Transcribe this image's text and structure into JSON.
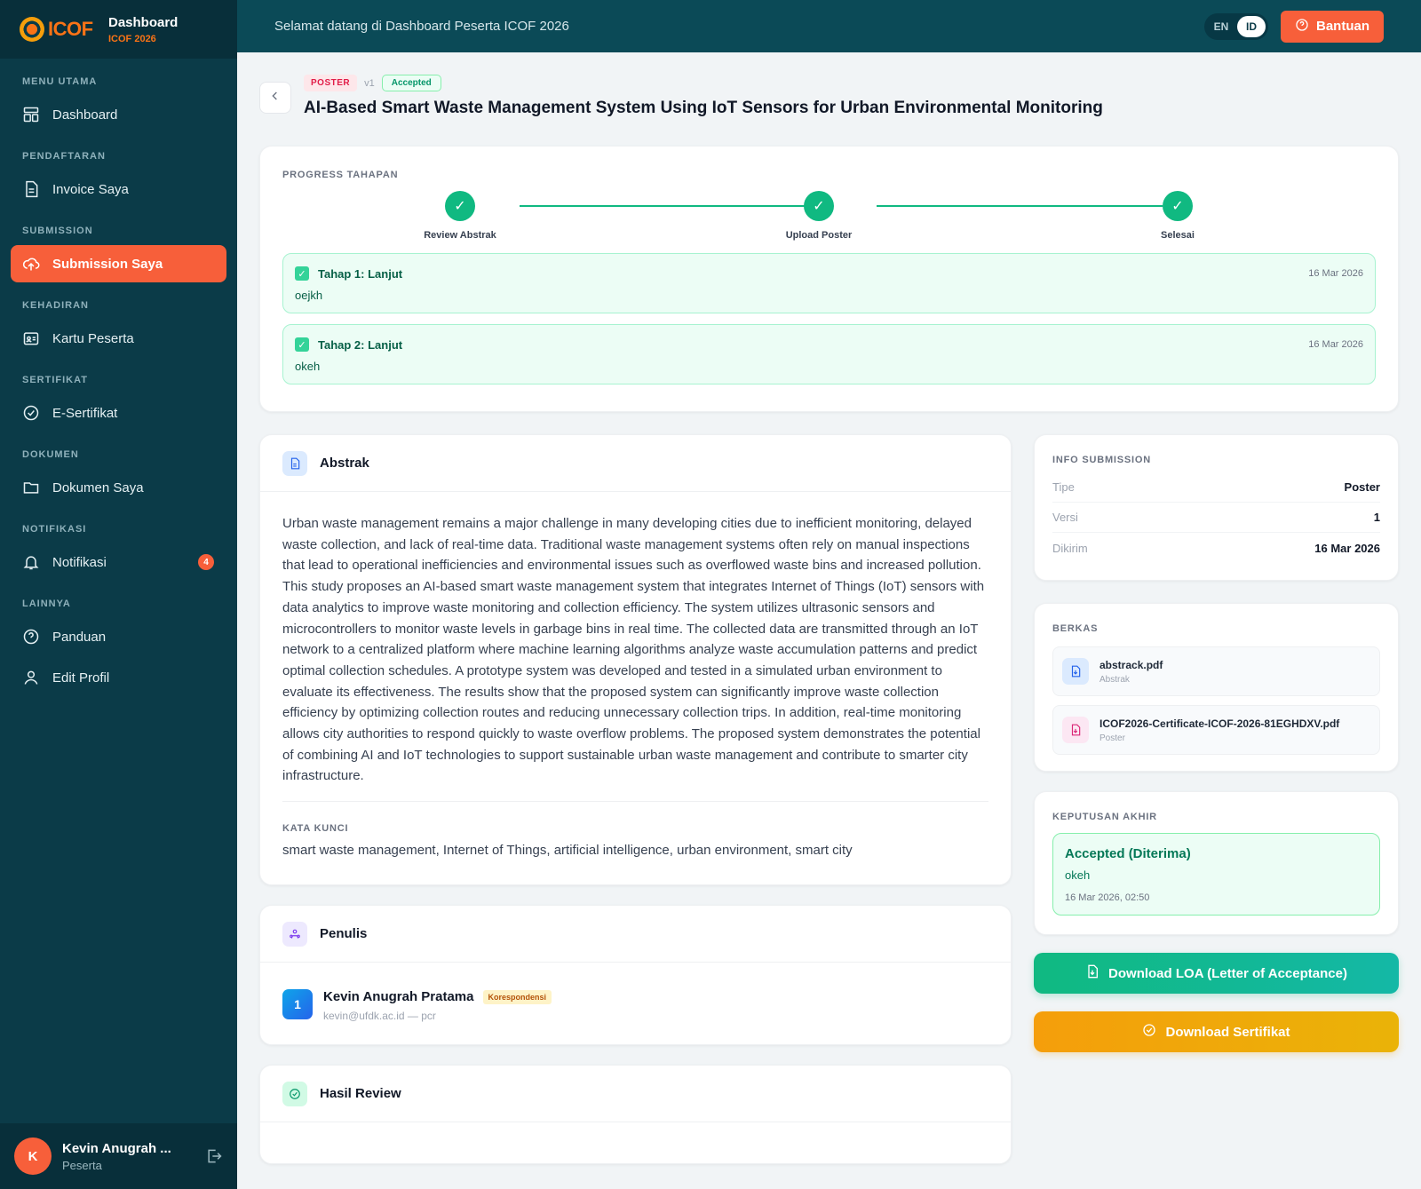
{
  "brand": {
    "logo_text": "ICOF",
    "title": "Dashboard",
    "subtitle": "ICOF 2026"
  },
  "sidebar": {
    "sections": [
      {
        "label": "MENU UTAMA",
        "items": [
          {
            "label": "Dashboard",
            "icon": "dashboard-icon"
          }
        ]
      },
      {
        "label": "PENDAFTARAN",
        "items": [
          {
            "label": "Invoice Saya",
            "icon": "document-icon"
          }
        ]
      },
      {
        "label": "SUBMISSION",
        "items": [
          {
            "label": "Submission Saya",
            "icon": "upload-cloud-icon",
            "active": true
          }
        ]
      },
      {
        "label": "KEHADIRAN",
        "items": [
          {
            "label": "Kartu Peserta",
            "icon": "id-card-icon"
          }
        ]
      },
      {
        "label": "SERTIFIKAT",
        "items": [
          {
            "label": "E-Sertifikat",
            "icon": "badge-check-icon"
          }
        ]
      },
      {
        "label": "DOKUMEN",
        "items": [
          {
            "label": "Dokumen Saya",
            "icon": "folder-icon"
          }
        ]
      },
      {
        "label": "NOTIFIKASI",
        "items": [
          {
            "label": "Notifikasi",
            "icon": "bell-icon",
            "badge": "4"
          }
        ]
      },
      {
        "label": "LAINNYA",
        "items": [
          {
            "label": "Panduan",
            "icon": "help-circle-icon"
          },
          {
            "label": "Edit Profil",
            "icon": "user-icon"
          }
        ]
      }
    ]
  },
  "user": {
    "initial": "K",
    "name": "Kevin Anugrah ...",
    "role": "Peserta"
  },
  "topbar": {
    "welcome": "Selamat datang di Dashboard Peserta ICOF 2026",
    "lang_en": "EN",
    "lang_id": "ID",
    "help_label": "Bantuan"
  },
  "submission": {
    "type_chip": "POSTER",
    "version": "v1",
    "status_chip": "Accepted",
    "title": "AI-Based Smart Waste Management System Using IoT Sensors for Urban Environmental Monitoring"
  },
  "progress": {
    "label": "PROGRESS TAHAPAN",
    "steps": [
      "Review Abstrak",
      "Upload Poster",
      "Selesai"
    ],
    "stages": [
      {
        "title": "Tahap 1: Lanjut",
        "date": "16 Mar 2026",
        "note": "oejkh"
      },
      {
        "title": "Tahap 2: Lanjut",
        "date": "16 Mar 2026",
        "note": "okeh"
      }
    ]
  },
  "abstract": {
    "title": "Abstrak",
    "text": "Urban waste management remains a major challenge in many developing cities due to inefficient monitoring, delayed waste collection, and lack of real-time data. Traditional waste management systems often rely on manual inspections that lead to operational inefficiencies and environmental issues such as overflowed waste bins and increased pollution. This study proposes an AI-based smart waste management system that integrates Internet of Things (IoT) sensors with data analytics to improve waste monitoring and collection efficiency. The system utilizes ultrasonic sensors and microcontrollers to monitor waste levels in garbage bins in real time. The collected data are transmitted through an IoT network to a centralized platform where machine learning algorithms analyze waste accumulation patterns and predict optimal collection schedules. A prototype system was developed and tested in a simulated urban environment to evaluate its effectiveness. The results show that the proposed system can significantly improve waste collection efficiency by optimizing collection routes and reducing unnecessary collection trips. In addition, real-time monitoring allows city authorities to respond quickly to waste overflow problems. The proposed system demonstrates the potential of combining AI and IoT technologies to support sustainable urban waste management and contribute to smarter city infrastructure.",
    "keywords_label": "KATA KUNCI",
    "keywords": "smart waste management, Internet of Things, artificial intelligence, urban environment, smart city"
  },
  "authors": {
    "title": "Penulis",
    "list": [
      {
        "number": "1",
        "name": "Kevin Anugrah Pratama",
        "tag": "Korespondensi",
        "email": "kevin@ufdk.ac.id — pcr"
      }
    ]
  },
  "review": {
    "title": "Hasil Review"
  },
  "info": {
    "label": "INFO SUBMISSION",
    "rows": [
      {
        "key": "Tipe",
        "value": "Poster"
      },
      {
        "key": "Versi",
        "value": "1"
      },
      {
        "key": "Dikirim",
        "value": "16 Mar 2026"
      }
    ]
  },
  "files": {
    "label": "BERKAS",
    "items": [
      {
        "name": "abstrack.pdf",
        "type": "Abstrak",
        "color": "#2563eb"
      },
      {
        "name": "ICOF2026-Certificate-ICOF-2026-81EGHDXV.pdf",
        "type": "Poster",
        "color": "#db2777"
      }
    ]
  },
  "decision": {
    "label": "KEPUTUSAN AKHIR",
    "title": "Accepted (Diterima)",
    "note": "okeh",
    "date": "16 Mar 2026, 02:50"
  },
  "actions": {
    "loa_label": "Download LOA (Letter of Acceptance)",
    "cert_label": "Download Sertifikat"
  },
  "colors": {
    "sidebar": "#0b3b48",
    "accent": "#f75f3a",
    "success": "#10b981",
    "warning": "#f59e0b"
  }
}
